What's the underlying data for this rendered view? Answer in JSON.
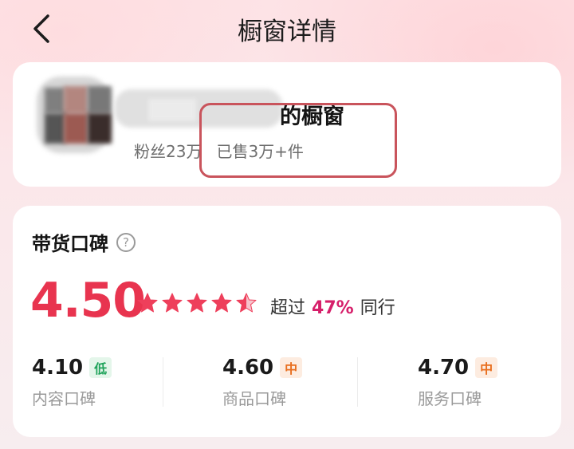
{
  "header": {
    "title": "橱窗详情",
    "back_icon": "chevron-left-icon"
  },
  "shop": {
    "name_suffix": "的橱窗",
    "followers": "粉丝23万",
    "sold": "已售3万+件"
  },
  "rating": {
    "section_title": "带货口碑",
    "help_icon_text": "?",
    "overall": "4.50",
    "stars": 4.5,
    "beyond_prefix": "超过",
    "beyond_pct": "47%",
    "beyond_suffix": "同行",
    "items": [
      {
        "score": "4.10",
        "level": "低",
        "label": "内容口碑"
      },
      {
        "score": "4.60",
        "level": "中",
        "label": "商品口碑"
      },
      {
        "score": "4.70",
        "level": "中",
        "label": "服务口碑"
      }
    ]
  },
  "colors": {
    "accent_red": "#e8344f",
    "pct_magenta": "#d61f6a",
    "tag_low": "#1fa35a",
    "tag_mid": "#e86f1f",
    "annotation_box": "#c9545c"
  }
}
